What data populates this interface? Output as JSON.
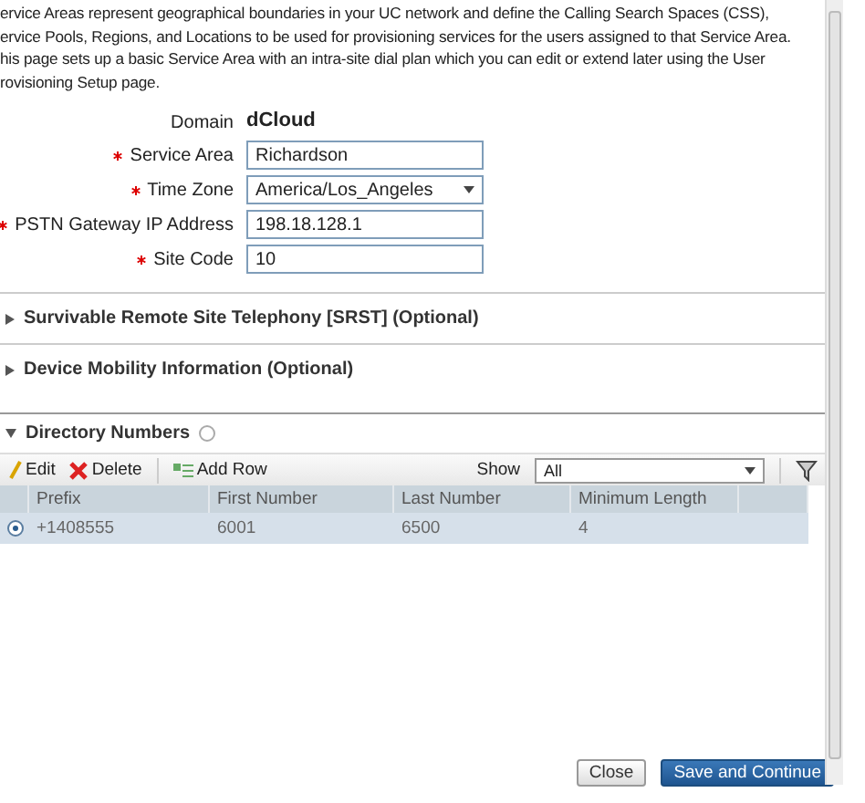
{
  "intro": {
    "lines": [
      "ervice Areas represent geographical boundaries in your UC network and define the Calling Search Spaces (CSS),",
      "ervice Pools, Regions, and Locations to be used for provisioning services for the users assigned to that Service Area.",
      "his page sets up a basic Service Area with an intra-site dial plan which you can edit or extend later using the User",
      "rovisioning Setup page."
    ]
  },
  "form": [
    {
      "kind": "static",
      "label": "Domain",
      "required": false,
      "value": "dCloud"
    },
    {
      "kind": "text",
      "label": "Service Area",
      "required": true,
      "value": "Richardson"
    },
    {
      "kind": "select",
      "label": "Time Zone",
      "required": true,
      "value": "America/Los_Angeles"
    },
    {
      "kind": "text",
      "label": "PSTN Gateway IP Address",
      "required": true,
      "value": "198.18.128.1"
    },
    {
      "kind": "text",
      "label": "Site Code",
      "required": true,
      "value": "10"
    }
  ],
  "sections": [
    {
      "title": "Survivable Remote Site Telephony [SRST] (Optional)",
      "expanded": false
    },
    {
      "title": "Device Mobility Information (Optional)",
      "expanded": false
    }
  ],
  "directory": {
    "title": "Directory Numbers",
    "expanded": true,
    "toolbar": {
      "edit": "Edit",
      "delete": "Delete",
      "add": "Add Row",
      "show_label": "Show",
      "show_value": "All"
    },
    "columns": [
      "Prefix",
      "First Number",
      "Last Number",
      "Minimum Length"
    ],
    "rows": [
      {
        "selected": true,
        "cells": [
          "+1408555",
          "6001",
          "6500",
          "4"
        ]
      }
    ]
  },
  "buttons": [
    {
      "label": "Close",
      "kind": "secondary"
    },
    {
      "label": "Save and Continue",
      "kind": "primary"
    }
  ]
}
